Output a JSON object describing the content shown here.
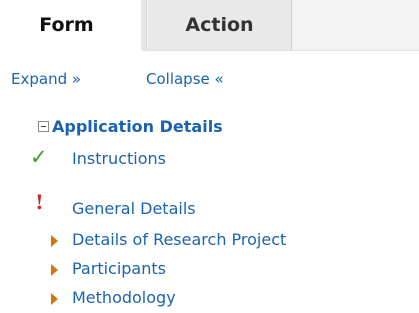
{
  "tabs": [
    {
      "label": "Form",
      "selected": true
    },
    {
      "label": "Action",
      "selected": false
    }
  ],
  "links": {
    "expand": "Expand »",
    "collapse": "Collapse «"
  },
  "tree": {
    "root": {
      "label": "Application Details",
      "expanded": true
    },
    "items": [
      {
        "label": "Instructions",
        "status": "check-icon"
      },
      {
        "label": "General Details",
        "status": "exclamation-icon"
      },
      {
        "label": "Details of Research Project",
        "status": "arrow-right-icon"
      },
      {
        "label": "Participants",
        "status": "arrow-right-icon"
      },
      {
        "label": "Methodology",
        "status": "arrow-right-icon"
      }
    ]
  },
  "colors": {
    "link": "#1a63b0",
    "check": "#3aa11a",
    "warning": "#d21f1f",
    "arrow": "#cc7a10"
  }
}
